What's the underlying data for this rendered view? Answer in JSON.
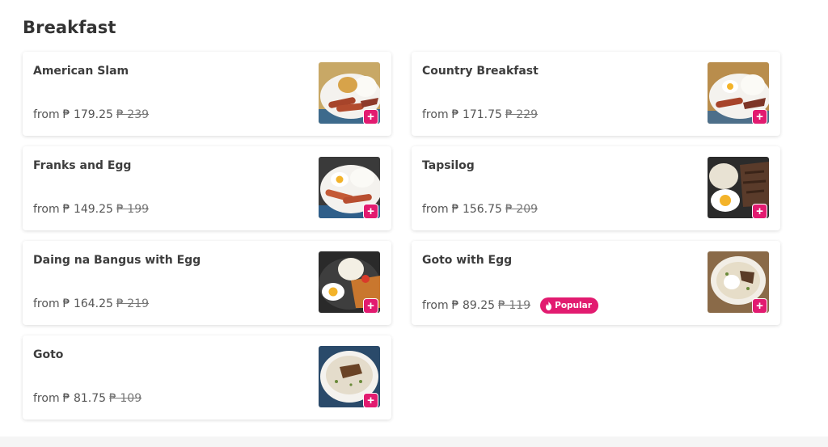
{
  "section": {
    "title": "Breakfast"
  },
  "colors": {
    "accent": "#e21b70",
    "text": "#333333",
    "footer": "#f5f5f5"
  },
  "items": [
    {
      "name": "American Slam",
      "price_prefix": "from",
      "price": "₱ 179.25",
      "old_price": "₱ 239",
      "badge": "",
      "image": "american-slam-photo"
    },
    {
      "name": "Country Breakfast",
      "price_prefix": "from",
      "price": "₱ 171.75",
      "old_price": "₱ 229",
      "badge": "",
      "image": "country-breakfast-photo"
    },
    {
      "name": "Franks and Egg",
      "price_prefix": "from",
      "price": "₱ 149.25",
      "old_price": "₱ 199",
      "badge": "",
      "image": "franks-and-egg-photo"
    },
    {
      "name": "Tapsilog",
      "price_prefix": "from",
      "price": "₱ 156.75",
      "old_price": "₱ 209",
      "badge": "",
      "image": "tapsilog-photo"
    },
    {
      "name": "Daing na Bangus with Egg",
      "price_prefix": "from",
      "price": "₱ 164.25",
      "old_price": "₱ 219",
      "badge": "",
      "image": "daing-na-bangus-photo"
    },
    {
      "name": "Goto with Egg",
      "price_prefix": "from",
      "price": "₱ 89.25",
      "old_price": "₱ 119",
      "badge": "Popular",
      "image": "goto-with-egg-photo"
    },
    {
      "name": "Goto",
      "price_prefix": "from",
      "price": "₱ 81.75",
      "old_price": "₱ 109",
      "badge": "",
      "image": "goto-photo"
    }
  ],
  "add_button": {
    "symbol": "+"
  },
  "badge_icon": "flame-icon"
}
